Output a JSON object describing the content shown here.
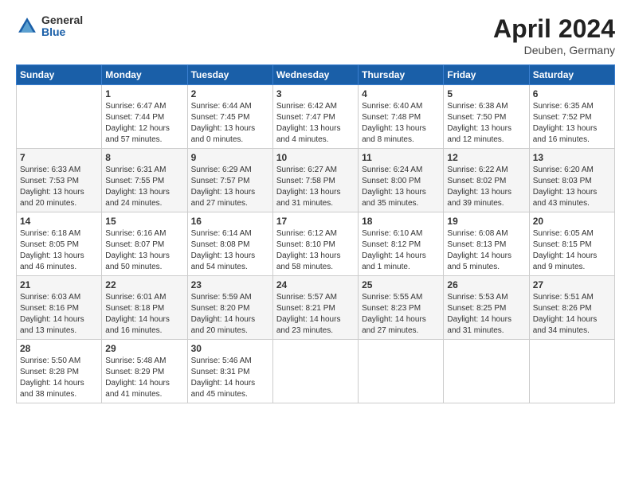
{
  "header": {
    "logo_general": "General",
    "logo_blue": "Blue",
    "month_year": "April 2024",
    "location": "Deuben, Germany"
  },
  "weekdays": [
    "Sunday",
    "Monday",
    "Tuesday",
    "Wednesday",
    "Thursday",
    "Friday",
    "Saturday"
  ],
  "weeks": [
    [
      {
        "day": "",
        "info": ""
      },
      {
        "day": "1",
        "info": "Sunrise: 6:47 AM\nSunset: 7:44 PM\nDaylight: 12 hours\nand 57 minutes."
      },
      {
        "day": "2",
        "info": "Sunrise: 6:44 AM\nSunset: 7:45 PM\nDaylight: 13 hours\nand 0 minutes."
      },
      {
        "day": "3",
        "info": "Sunrise: 6:42 AM\nSunset: 7:47 PM\nDaylight: 13 hours\nand 4 minutes."
      },
      {
        "day": "4",
        "info": "Sunrise: 6:40 AM\nSunset: 7:48 PM\nDaylight: 13 hours\nand 8 minutes."
      },
      {
        "day": "5",
        "info": "Sunrise: 6:38 AM\nSunset: 7:50 PM\nDaylight: 13 hours\nand 12 minutes."
      },
      {
        "day": "6",
        "info": "Sunrise: 6:35 AM\nSunset: 7:52 PM\nDaylight: 13 hours\nand 16 minutes."
      }
    ],
    [
      {
        "day": "7",
        "info": "Sunrise: 6:33 AM\nSunset: 7:53 PM\nDaylight: 13 hours\nand 20 minutes."
      },
      {
        "day": "8",
        "info": "Sunrise: 6:31 AM\nSunset: 7:55 PM\nDaylight: 13 hours\nand 24 minutes."
      },
      {
        "day": "9",
        "info": "Sunrise: 6:29 AM\nSunset: 7:57 PM\nDaylight: 13 hours\nand 27 minutes."
      },
      {
        "day": "10",
        "info": "Sunrise: 6:27 AM\nSunset: 7:58 PM\nDaylight: 13 hours\nand 31 minutes."
      },
      {
        "day": "11",
        "info": "Sunrise: 6:24 AM\nSunset: 8:00 PM\nDaylight: 13 hours\nand 35 minutes."
      },
      {
        "day": "12",
        "info": "Sunrise: 6:22 AM\nSunset: 8:02 PM\nDaylight: 13 hours\nand 39 minutes."
      },
      {
        "day": "13",
        "info": "Sunrise: 6:20 AM\nSunset: 8:03 PM\nDaylight: 13 hours\nand 43 minutes."
      }
    ],
    [
      {
        "day": "14",
        "info": "Sunrise: 6:18 AM\nSunset: 8:05 PM\nDaylight: 13 hours\nand 46 minutes."
      },
      {
        "day": "15",
        "info": "Sunrise: 6:16 AM\nSunset: 8:07 PM\nDaylight: 13 hours\nand 50 minutes."
      },
      {
        "day": "16",
        "info": "Sunrise: 6:14 AM\nSunset: 8:08 PM\nDaylight: 13 hours\nand 54 minutes."
      },
      {
        "day": "17",
        "info": "Sunrise: 6:12 AM\nSunset: 8:10 PM\nDaylight: 13 hours\nand 58 minutes."
      },
      {
        "day": "18",
        "info": "Sunrise: 6:10 AM\nSunset: 8:12 PM\nDaylight: 14 hours\nand 1 minute."
      },
      {
        "day": "19",
        "info": "Sunrise: 6:08 AM\nSunset: 8:13 PM\nDaylight: 14 hours\nand 5 minutes."
      },
      {
        "day": "20",
        "info": "Sunrise: 6:05 AM\nSunset: 8:15 PM\nDaylight: 14 hours\nand 9 minutes."
      }
    ],
    [
      {
        "day": "21",
        "info": "Sunrise: 6:03 AM\nSunset: 8:16 PM\nDaylight: 14 hours\nand 13 minutes."
      },
      {
        "day": "22",
        "info": "Sunrise: 6:01 AM\nSunset: 8:18 PM\nDaylight: 14 hours\nand 16 minutes."
      },
      {
        "day": "23",
        "info": "Sunrise: 5:59 AM\nSunset: 8:20 PM\nDaylight: 14 hours\nand 20 minutes."
      },
      {
        "day": "24",
        "info": "Sunrise: 5:57 AM\nSunset: 8:21 PM\nDaylight: 14 hours\nand 23 minutes."
      },
      {
        "day": "25",
        "info": "Sunrise: 5:55 AM\nSunset: 8:23 PM\nDaylight: 14 hours\nand 27 minutes."
      },
      {
        "day": "26",
        "info": "Sunrise: 5:53 AM\nSunset: 8:25 PM\nDaylight: 14 hours\nand 31 minutes."
      },
      {
        "day": "27",
        "info": "Sunrise: 5:51 AM\nSunset: 8:26 PM\nDaylight: 14 hours\nand 34 minutes."
      }
    ],
    [
      {
        "day": "28",
        "info": "Sunrise: 5:50 AM\nSunset: 8:28 PM\nDaylight: 14 hours\nand 38 minutes."
      },
      {
        "day": "29",
        "info": "Sunrise: 5:48 AM\nSunset: 8:29 PM\nDaylight: 14 hours\nand 41 minutes."
      },
      {
        "day": "30",
        "info": "Sunrise: 5:46 AM\nSunset: 8:31 PM\nDaylight: 14 hours\nand 45 minutes."
      },
      {
        "day": "",
        "info": ""
      },
      {
        "day": "",
        "info": ""
      },
      {
        "day": "",
        "info": ""
      },
      {
        "day": "",
        "info": ""
      }
    ]
  ]
}
